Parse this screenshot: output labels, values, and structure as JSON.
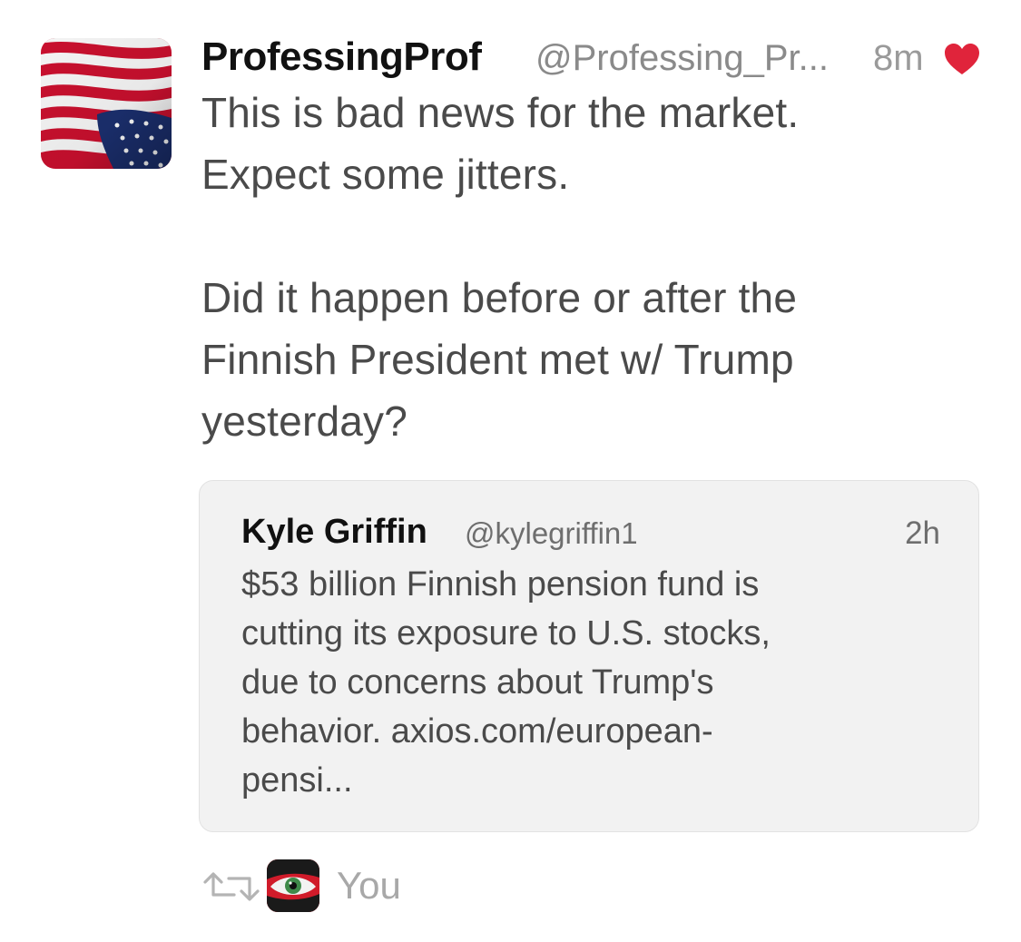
{
  "tweet": {
    "display_name": "ProfessingProf",
    "handle": "@Professing_Pr...",
    "time": "8m",
    "liked_icon": "heart-icon",
    "text": "This is bad news for the market.\nExpect some jitters.\n\nDid it happen before or after the\nFinnish President met w/ Trump\nyesterday?",
    "avatar_icon": "us-flag-avatar"
  },
  "quote": {
    "display_name": "Kyle Griffin",
    "handle": "@kylegriffin1",
    "time": "2h",
    "text": "$53 billion Finnish pension fund is\ncutting its exposure to U.S. stocks,\ndue to concerns about Trump's\nbehavior. axios.com/european-\npensi..."
  },
  "retweet": {
    "icon": "retweet-icon",
    "avatar_icon": "eye-avatar",
    "user": "You"
  },
  "colors": {
    "heart": "#e0243b",
    "name": "#111111",
    "text": "#4a4a4a",
    "muted": "#8a8a8a",
    "card_bg": "#f2f2f2"
  }
}
